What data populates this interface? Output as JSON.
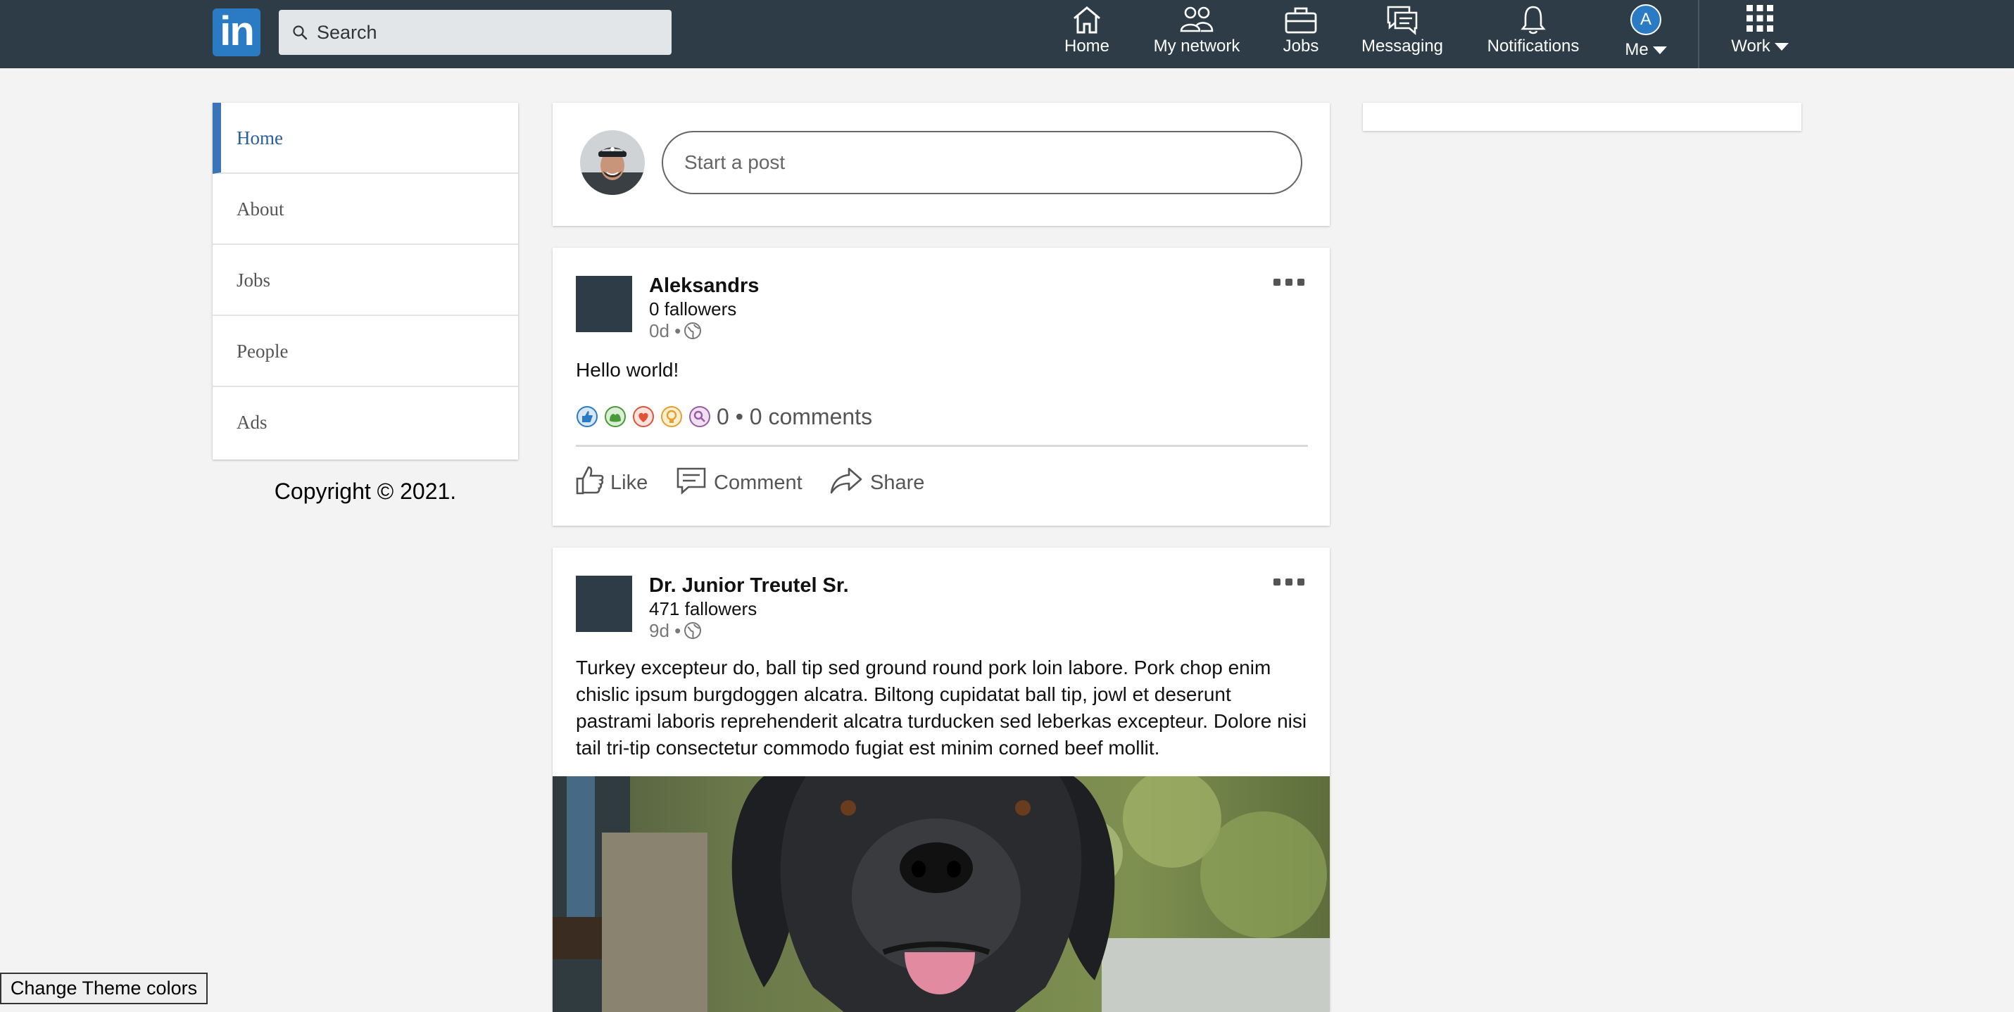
{
  "topbar": {
    "logo_text": "in",
    "search_placeholder": "Search",
    "nav": [
      {
        "label": "Home",
        "icon": "home-icon"
      },
      {
        "label": "My network",
        "icon": "network-icon"
      },
      {
        "label": "Jobs",
        "icon": "briefcase-icon"
      },
      {
        "label": "Messaging",
        "icon": "messaging-icon"
      },
      {
        "label": "Notifications",
        "icon": "bell-icon"
      },
      {
        "label": "Me",
        "icon": "avatar",
        "avatar_letter": "A"
      },
      {
        "label": "Work",
        "icon": "grid-icon"
      }
    ],
    "colors": {
      "bar": "#2e3c48",
      "accent": "#2a7bc4"
    }
  },
  "sidebar": {
    "items": [
      {
        "label": "Home",
        "active": true
      },
      {
        "label": "About"
      },
      {
        "label": "Jobs"
      },
      {
        "label": "People"
      },
      {
        "label": "Ads"
      }
    ],
    "copyright": "Copyright © 2021."
  },
  "composer": {
    "placeholder": "Start a post"
  },
  "posts": [
    {
      "author": "Aleksandrs",
      "followers": "0 fallowers",
      "time": "0d •",
      "text": "Hello world!",
      "reaction_summary": "0 • 0 comments",
      "actions": {
        "like": "Like",
        "comment": "Comment",
        "share": "Share"
      }
    },
    {
      "author": "Dr. Junior Treutel Sr.",
      "followers": "471 fallowers",
      "time": "9d •",
      "text": "Turkey excepteur do, ball tip sed ground round pork loin labore. Pork chop enim chislic ipsum burgdoggen alcatra. Biltong cupidatat ball tip, jowl et deserunt pastrami laboris reprehenderit alcatra turducken sed leberkas excepteur. Dolore nisi tail tri-tip consectetur commodo fugiat est minim corned beef mollit.",
      "image": "black-dog-photo"
    }
  ],
  "theme_button": "Change Theme colors"
}
